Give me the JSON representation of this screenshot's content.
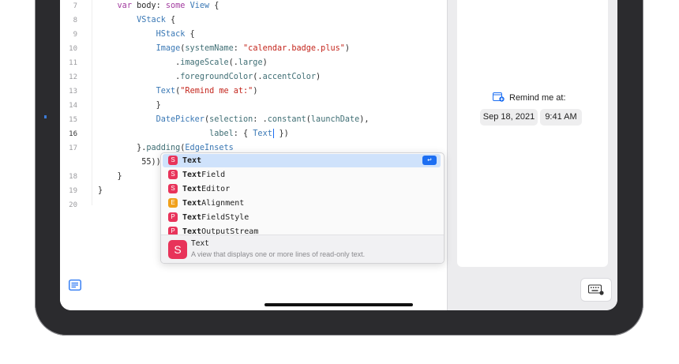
{
  "editor": {
    "lines": [
      {
        "num": "7",
        "html": "    <span class=\"kw\">var</span> body: <span class=\"kw\">some</span> <span class=\"ty\">View</span> {"
      },
      {
        "num": "8",
        "html": "        <span class=\"ty\">VStack</span> {"
      },
      {
        "num": "9",
        "html": "            <span class=\"ty\">HStack</span> {"
      },
      {
        "num": "10",
        "html": "            <span class=\"ty\">Image</span>(<span class=\"mem\">systemName</span>: <span class=\"str\">\"calendar.badge.plus\"</span>)"
      },
      {
        "num": "11",
        "html": "                .<span class=\"mem\">imageScale</span>(.<span class=\"mem\">large</span>)"
      },
      {
        "num": "12",
        "html": "                .<span class=\"mem\">foregroundColor</span>(.<span class=\"mem\">accentColor</span>)"
      },
      {
        "num": "13",
        "html": "            <span class=\"ty\">Text</span>(<span class=\"str\">\"Remind me at:\"</span>)"
      },
      {
        "num": "14",
        "html": "            }"
      },
      {
        "num": "15",
        "html": "            <span class=\"ty\">DatePicker</span>(<span class=\"mem\">selection</span>: .<span class=\"mem\">constant</span>(<span class=\"mem\">launchDate</span>),"
      },
      {
        "num": "16",
        "html": "                       <span class=\"mem\">label</span>: { <span class=\"ty\">Text</span><span class=\"caret\"></span> })"
      },
      {
        "num": "17",
        "html": "        }.<span class=\"mem\">padding</span>(<span class=\"ty\">EdgeInsets</span>"
      },
      {
        "num": "",
        "html": "         55))"
      },
      {
        "num": "18",
        "html": "    }"
      },
      {
        "num": "19",
        "html": "}"
      },
      {
        "num": "20",
        "html": ""
      }
    ]
  },
  "autocomplete": {
    "items": [
      {
        "badge": "S",
        "color": "#e8335a",
        "match": "Text",
        "rest": ""
      },
      {
        "badge": "S",
        "color": "#e8335a",
        "match": "Text",
        "rest": "Field"
      },
      {
        "badge": "S",
        "color": "#e8335a",
        "match": "Text",
        "rest": "Editor"
      },
      {
        "badge": "E",
        "color": "#f0a01a",
        "match": "Text",
        "rest": "Alignment"
      },
      {
        "badge": "P",
        "color": "#e8335a",
        "match": "Text",
        "rest": "FieldStyle"
      },
      {
        "badge": "P",
        "color": "#e8335a",
        "match": "Text",
        "rest": "OutputStream"
      }
    ],
    "enter_symbol": "↩",
    "detail": {
      "badge": "S",
      "title": "Text",
      "description": "A view that displays one or more lines of read-only text."
    }
  },
  "preview": {
    "remind_label": "Remind me at:",
    "date": "Sep 18, 2021",
    "time": "9:41 AM"
  },
  "colors": {
    "accent": "#1c6ef2",
    "struct_badge": "#e8335a",
    "enum_badge": "#f0a01a"
  }
}
